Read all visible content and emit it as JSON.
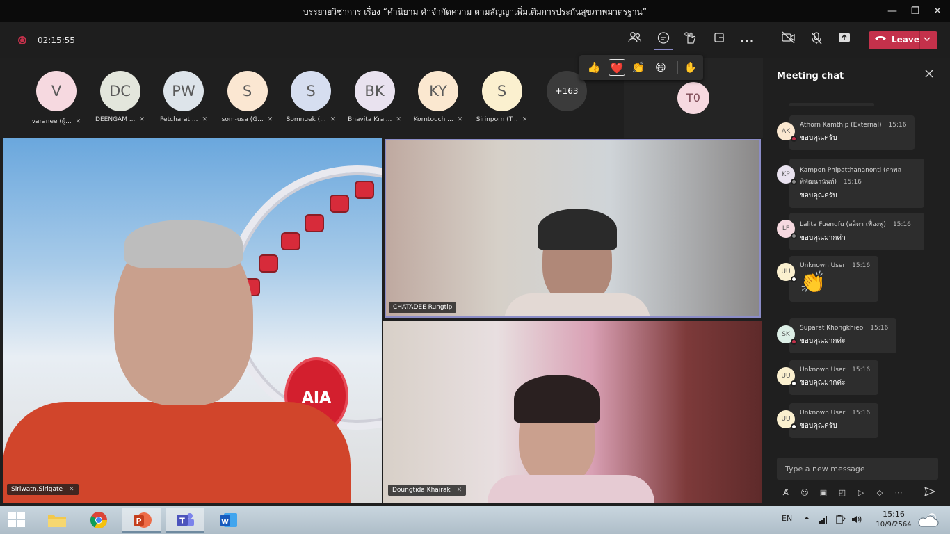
{
  "window": {
    "title": "บรรยายวิชาการ เรื่อง “คำนิยาม คำจำกัดความ ตามสัญญาเพิ่มเติมการประกันสุขภาพมาตรฐาน”",
    "minimize_glyph": "—",
    "maximize_glyph": "❐",
    "close_glyph": "✕"
  },
  "toolbar": {
    "timer": "02:15:55",
    "leave_label": "Leave",
    "icons": [
      "participants-icon",
      "chat-icon",
      "reactions-icon",
      "share-tray-icon",
      "more-options-icon",
      "camera-off-icon",
      "mic-off-icon",
      "share-icon"
    ]
  },
  "reactions": [
    "👍",
    "❤️",
    "👏",
    "😄",
    "✋"
  ],
  "participants": [
    {
      "initials": "V",
      "name": "varanee (ผู้...",
      "color": "#f6d9e0"
    },
    {
      "initials": "DC",
      "name": "DEENGAM ...",
      "color": "#e3e6dc"
    },
    {
      "initials": "PW",
      "name": "Petcharat ...",
      "color": "#dde4ea"
    },
    {
      "initials": "S",
      "name": "som-usa (G...",
      "color": "#fbe7d2"
    },
    {
      "initials": "S",
      "name": "Somnuek (...",
      "color": "#d6def0"
    },
    {
      "initials": "BK",
      "name": "Bhavita Krai...",
      "color": "#e9e2ef"
    },
    {
      "initials": "KY",
      "name": "Korntouch ...",
      "color": "#fbe8d0"
    },
    {
      "initials": "S",
      "name": "Sirinporn (T...",
      "color": "#fbf0cf"
    }
  ],
  "more_participants": "+163",
  "spotlight_participant": {
    "initials": "T0"
  },
  "videos": [
    {
      "name": "Siriwatn.Sirigate",
      "logo_text": "AIA"
    },
    {
      "name": "CHATADEE Rungtip"
    },
    {
      "name": "Doungtida Khairak"
    }
  ],
  "chat": {
    "title": "Meeting chat",
    "placeholder": "Type a new message",
    "messages": [
      {
        "initials": "AK",
        "author": "Athorn Kamthip (External)",
        "time": "15:16",
        "text": "ขอบคุณครับ",
        "avatar_color": "#fbe8d0",
        "status_color": "#c4314b"
      },
      {
        "initials": "KP",
        "author": "Kampon Phipatthananonti (ค่าพล",
        "author2": "พิพัฒนานันท์)",
        "time": "15:16",
        "text": "ขอบคุณครับ",
        "avatar_color": "#e9e2ef",
        "status_color": "#8a8a8a"
      },
      {
        "initials": "LF",
        "author": "Lalita Fuengfu (ลลิตา เฟื่องฟู)",
        "time": "15:16",
        "text": "ขอบคุณมากค่า",
        "avatar_color": "#f6d9e0",
        "status_color": "#8a8a8a"
      },
      {
        "initials": "UU",
        "author": "Unknown User",
        "time": "15:16",
        "emoji": "👏",
        "avatar_color": "#fbf0cf",
        "status_color": "#ffffff"
      },
      {
        "initials": "SK",
        "author": "Suparat Khongkhieo",
        "time": "15:16",
        "text": "ขอบคุณมากค่ะ",
        "avatar_color": "#dcefe6",
        "status_color": "#c4314b"
      },
      {
        "initials": "UU",
        "author": "Unknown User",
        "time": "15:16",
        "text": "ขอบคุณมากค่ะ",
        "avatar_color": "#fbf0cf",
        "status_color": "#ffffff"
      },
      {
        "initials": "UU",
        "author": "Unknown User",
        "time": "15:16",
        "text": "ขอบคุณครับ",
        "avatar_color": "#fbf0cf",
        "status_color": "#ffffff"
      }
    ]
  },
  "taskbar": {
    "language": "EN",
    "time": "15:16",
    "date": "10/9/2564",
    "apps": [
      "file-explorer",
      "chrome",
      "powerpoint",
      "teams",
      "word"
    ]
  },
  "colors": {
    "accent": "#8b8cc7",
    "leave": "#c4314b",
    "recording": "#c4314b"
  }
}
